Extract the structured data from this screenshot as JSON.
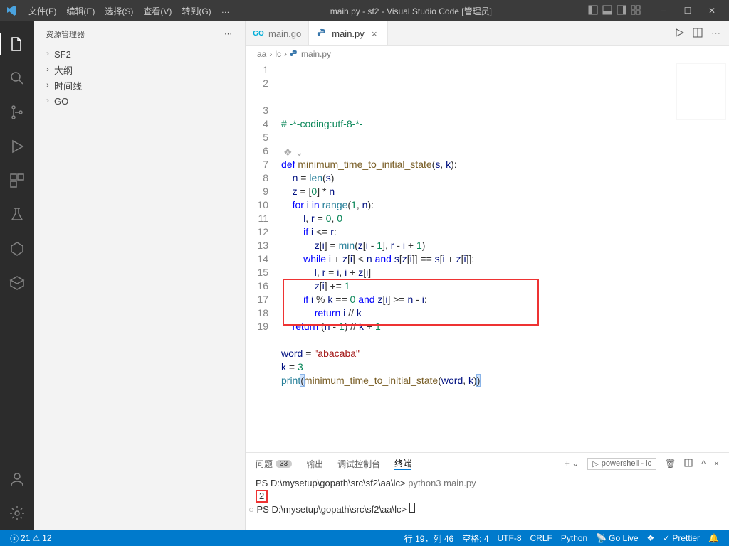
{
  "menubar": {
    "items": [
      "文件(F)",
      "编辑(E)",
      "选择(S)",
      "查看(V)",
      "转到(G)",
      "…"
    ]
  },
  "window_title": "main.py - sf2 - Visual Studio Code [管理员]",
  "sidebar": {
    "title": "资源管理器",
    "items": [
      {
        "label": "SF2"
      },
      {
        "label": "大纲"
      },
      {
        "label": "时间线"
      },
      {
        "label": "GO"
      }
    ]
  },
  "tabs": [
    {
      "label": "main.go",
      "icon": "go",
      "active": false
    },
    {
      "label": "main.py",
      "icon": "py",
      "active": true
    }
  ],
  "breadcrumb": [
    "aa",
    "lc",
    "main.py"
  ],
  "code": {
    "lines": [
      {
        "n": 1,
        "html": "<span class='c-comment'># -*-coding:utf-8-*-</span>"
      },
      {
        "n": 2,
        "html": ""
      },
      {
        "n": 3,
        "html": "<span class='c-kw'>def</span> <span class='c-fn'>minimum_time_to_initial_state</span>(<span class='c-var'>s</span>, <span class='c-var'>k</span>):"
      },
      {
        "n": 4,
        "html": "    <span class='c-var'>n</span> = <span class='c-builtin'>len</span>(<span class='c-var'>s</span>)"
      },
      {
        "n": 5,
        "html": "    <span class='c-var'>z</span> = [<span class='c-num'>0</span>] * <span class='c-var'>n</span>"
      },
      {
        "n": 6,
        "html": "    <span class='c-kw'>for</span> <span class='c-var'>i</span> <span class='c-kw'>in</span> <span class='c-builtin'>range</span>(<span class='c-num'>1</span>, <span class='c-var'>n</span>):"
      },
      {
        "n": 7,
        "html": "        <span class='c-var'>l</span>, <span class='c-var'>r</span> = <span class='c-num'>0</span>, <span class='c-num'>0</span>"
      },
      {
        "n": 8,
        "html": "        <span class='c-kw'>if</span> <span class='c-var'>i</span> &lt;= <span class='c-var'>r</span>:"
      },
      {
        "n": 9,
        "html": "            <span class='c-var'>z</span>[<span class='c-var'>i</span>] = <span class='c-builtin'>min</span>(<span class='c-var'>z</span>[<span class='c-var'>i</span> - <span class='c-num'>1</span>], <span class='c-var'>r</span> - <span class='c-var'>i</span> + <span class='c-num'>1</span>)"
      },
      {
        "n": 10,
        "html": "        <span class='c-kw'>while</span> <span class='c-var'>i</span> + <span class='c-var'>z</span>[<span class='c-var'>i</span>] &lt; <span class='c-var'>n</span> <span class='c-kw'>and</span> <span class='c-var'>s</span>[<span class='c-var'>z</span>[<span class='c-var'>i</span>]] == <span class='c-var'>s</span>[<span class='c-var'>i</span> + <span class='c-var'>z</span>[<span class='c-var'>i</span>]]:"
      },
      {
        "n": 11,
        "html": "            <span class='c-var'>l</span>, <span class='c-var'>r</span> = <span class='c-var'>i</span>, <span class='c-var'>i</span> + <span class='c-var'>z</span>[<span class='c-var'>i</span>]"
      },
      {
        "n": 12,
        "html": "            <span class='c-var'>z</span>[<span class='c-var'>i</span>] += <span class='c-num'>1</span>"
      },
      {
        "n": 13,
        "html": "        <span class='c-kw'>if</span> <span class='c-var'>i</span> % <span class='c-var'>k</span> == <span class='c-num'>0</span> <span class='c-kw'>and</span> <span class='c-var'>z</span>[<span class='c-var'>i</span>] &gt;= <span class='c-var'>n</span> - <span class='c-var'>i</span>:"
      },
      {
        "n": 14,
        "html": "            <span class='c-kw'>return</span> <span class='c-var'>i</span> // <span class='c-var'>k</span>"
      },
      {
        "n": 15,
        "html": "    <span class='c-kw'>return</span> (<span class='c-var'>n</span> - <span class='c-num'>1</span>) // <span class='c-var'>k</span> + <span class='c-num'>1</span>"
      },
      {
        "n": 16,
        "html": ""
      },
      {
        "n": 17,
        "html": "<span class='c-var'>word</span> = <span class='c-str'>\"abacaba\"</span>"
      },
      {
        "n": 18,
        "html": "<span class='c-var'>k</span> = <span class='c-num'>3</span>"
      },
      {
        "n": 19,
        "html": "<span class='c-builtin'>print</span><span class='cursel'>(</span><span class='c-fn'>minimum_time_to_initial_state</span>(<span class='c-var'>word</span>, <span class='c-var'>k</span>)<span class='cursel'>)</span>"
      }
    ]
  },
  "panel": {
    "tabs": [
      {
        "label": "问题",
        "badge": "33"
      },
      {
        "label": "输出"
      },
      {
        "label": "调试控制台"
      },
      {
        "label": "终端",
        "active": true
      }
    ],
    "shell": "powershell - lc",
    "terminal": {
      "prompt1": "PS D:\\mysetup\\gopath\\src\\sf2\\aa\\lc>",
      "cmd": "python3 main.py",
      "output": "2",
      "prompt2": "PS D:\\mysetup\\gopath\\src\\sf2\\aa\\lc>"
    }
  },
  "statusbar": {
    "errors": "21",
    "warnings": "12",
    "cursor": "行 19，列 46",
    "spaces": "空格: 4",
    "encoding": "UTF-8",
    "eol": "CRLF",
    "lang": "Python",
    "golive": "Go Live",
    "prettier": "Prettier"
  }
}
